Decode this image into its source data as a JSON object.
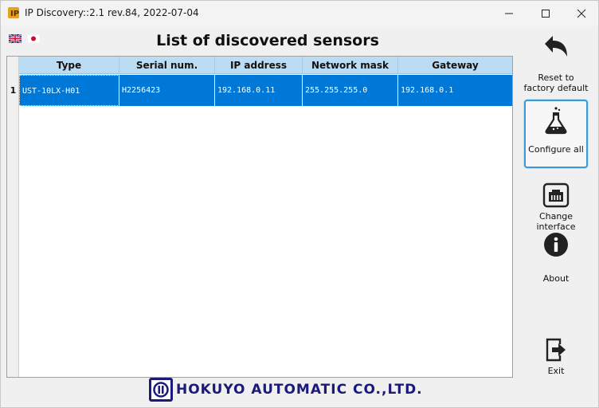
{
  "window": {
    "title": "IP Discovery::2.1 rev.84, 2022-07-04",
    "icon": "ip-discovery-app-icon"
  },
  "languages": [
    {
      "name": "uk-flag-icon"
    },
    {
      "name": "japan-flag-icon"
    }
  ],
  "list": {
    "title": "List of discovered sensors",
    "columns": [
      "Type",
      "Serial num.",
      "IP address",
      "Network mask",
      "Gateway"
    ],
    "rows": [
      {
        "number": "1",
        "cells": [
          "UST-10LX-H01",
          "H2256423",
          "192.168.0.11",
          "255.255.255.0",
          "192.168.0.1"
        ],
        "selected": true
      }
    ]
  },
  "actions": {
    "reset": {
      "label_line1": "Reset to",
      "label_line2": "factory default",
      "icon": "undo-arrow-icon"
    },
    "configure": {
      "label": "Configure all",
      "icon": "flask-icon"
    },
    "change_interface": {
      "label": "Change interface",
      "icon": "ethernet-port-icon"
    },
    "about": {
      "label": "About",
      "icon": "info-icon"
    },
    "exit": {
      "label": "Exit",
      "icon": "exit-icon"
    }
  },
  "brand": {
    "name": "HOKUYO AUTOMATIC CO.,LTD.",
    "color": "#1a1a7a"
  },
  "colors": {
    "selection": "#0078d7",
    "header": "#bcdcf4",
    "focus_border": "#3c9ad6"
  }
}
